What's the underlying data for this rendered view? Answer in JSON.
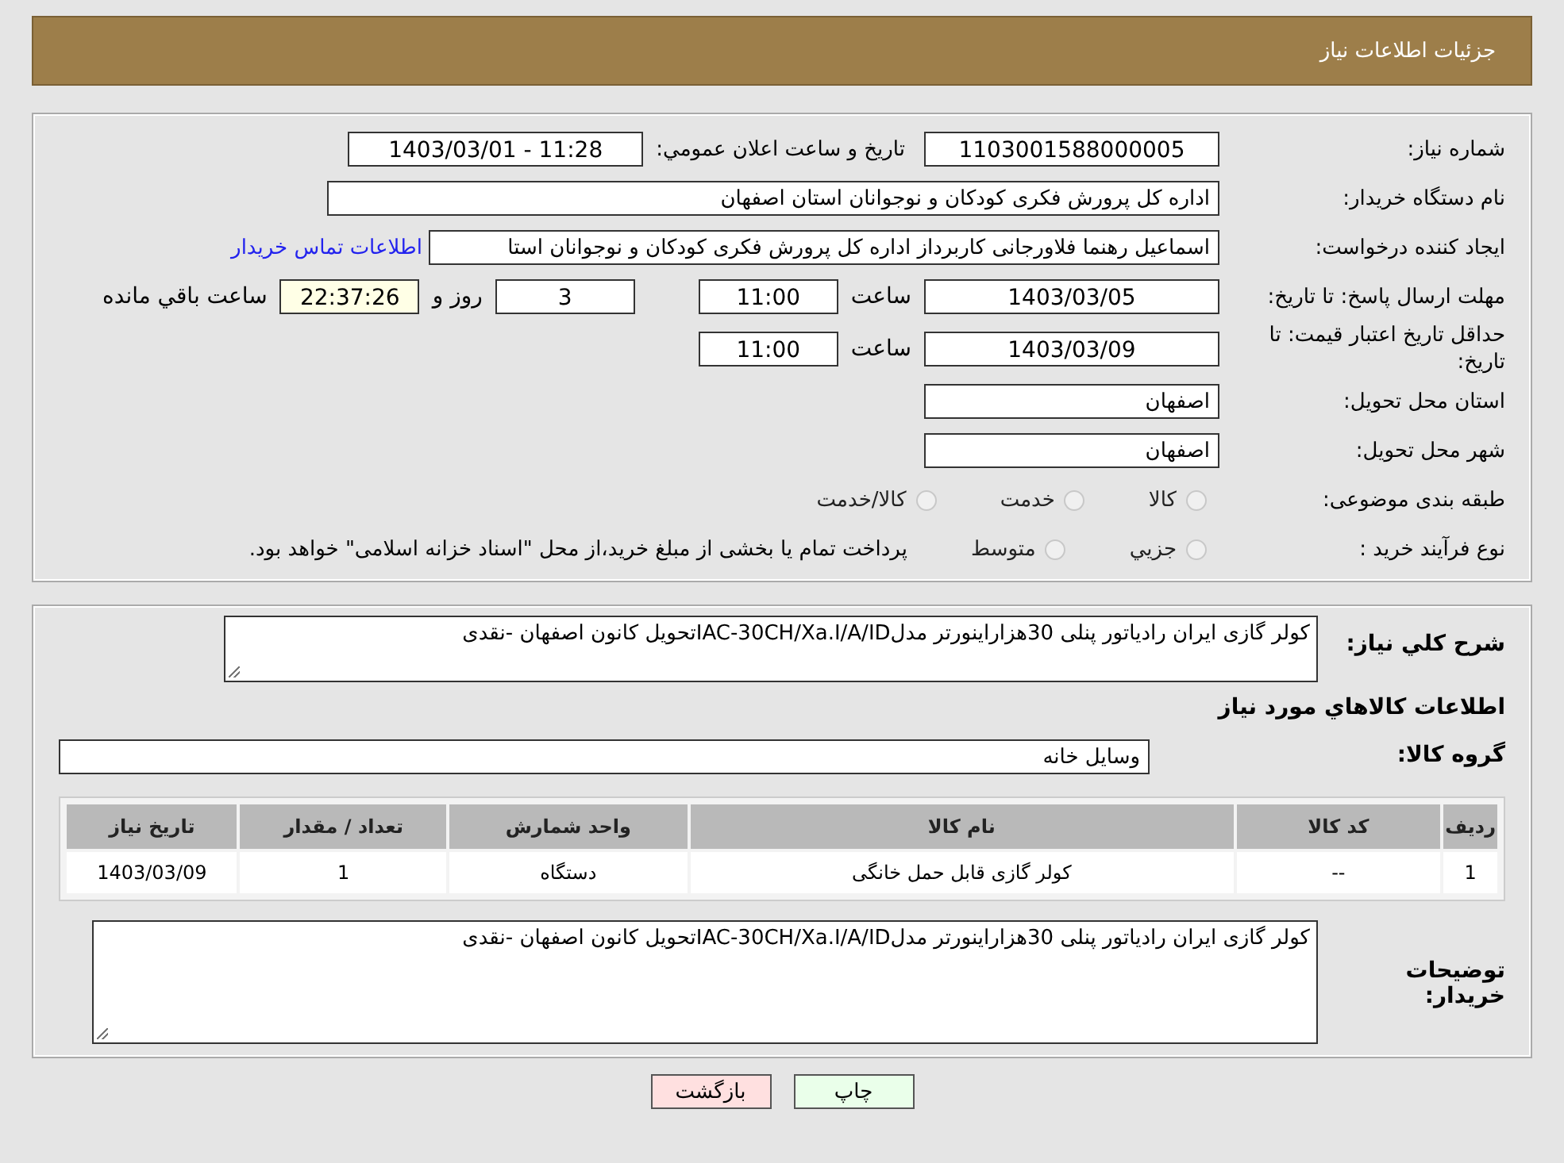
{
  "header": {
    "title": "جزئیات اطلاعات نیاز"
  },
  "fields": {
    "need_number": {
      "label": "شماره نیاز:",
      "value": "1103001588000005"
    },
    "announce_datetime": {
      "label": "تاریخ و ساعت اعلان عمومي:",
      "value": "1403/03/01 - 11:28"
    },
    "buyer_org": {
      "label": "نام دستگاه خریدار:",
      "value": "اداره کل پرورش فکری کودکان و نوجوانان استان اصفهان"
    },
    "requester": {
      "label": "ایجاد کننده درخواست:",
      "value": "اسماعیل رهنما فلاورجانی کاربرداز اداره کل پرورش فکری کودکان و نوجوانان استا",
      "link": "اطلاعات تماس خریدار"
    },
    "reply_deadline": {
      "label": "مهلت ارسال پاسخ: تا تاریخ:",
      "date": "1403/03/05",
      "time_label": "ساعت",
      "time": "11:00",
      "days": "3",
      "days_label": "روز و",
      "remaining": "22:37:26",
      "remaining_label": "ساعت باقي مانده"
    },
    "price_validity": {
      "label": "حداقل تاریخ اعتبار قیمت: تا تاریخ:",
      "date": "1403/03/09",
      "time_label": "ساعت",
      "time": "11:00"
    },
    "delivery_province": {
      "label": "استان محل تحویل:",
      "value": "اصفهان"
    },
    "delivery_city": {
      "label": "شهر محل تحویل:",
      "value": "اصفهان"
    },
    "category": {
      "label": "طبقه بندی موضوعی:",
      "options": [
        {
          "label": "کالا",
          "selected": false
        },
        {
          "label": "خدمت",
          "selected": false
        },
        {
          "label": "کالا/خدمت",
          "selected": false
        }
      ]
    },
    "purchase_type": {
      "label": "نوع فرآیند خرید :",
      "options": [
        {
          "label": "جزيي",
          "selected": false
        },
        {
          "label": "متوسط",
          "selected": false
        }
      ],
      "note": "پرداخت تمام یا بخشی از مبلغ خرید،از محل \"اسناد خزانه اسلامی\" خواهد بود."
    }
  },
  "description": {
    "label": "شرح کلي نیاز:",
    "value": "کولر گازی ایران رادیاتور پنلی 30هزاراینورتر مدلIAC-30CH/Xa.I/A/IDتحویل کانون اصفهان -نقدی"
  },
  "goods_section_title": "اطلاعات کالاهاي مورد نیاز",
  "goods_group": {
    "label": "گروه کالا:",
    "value": "وسایل خانه"
  },
  "table": {
    "columns": [
      "ردیف",
      "کد کالا",
      "نام کالا",
      "واحد شمارش",
      "تعداد / مقدار",
      "تاریخ نیاز"
    ],
    "rows": [
      [
        "1",
        "--",
        "کولر گازی قابل حمل خانگی",
        "دستگاه",
        "1",
        "1403/03/09"
      ]
    ]
  },
  "buyer_notes": {
    "label": "توضیحات خریدار:",
    "value": "کولر گازی ایران رادیاتور پنلی 30هزاراینورتر مدلIAC-30CH/Xa.I/A/IDتحویل کانون اصفهان -نقدی"
  },
  "buttons": [
    {
      "label": "چاپ",
      "kind": "print"
    },
    {
      "label": "بازگشت",
      "kind": "back"
    }
  ]
}
